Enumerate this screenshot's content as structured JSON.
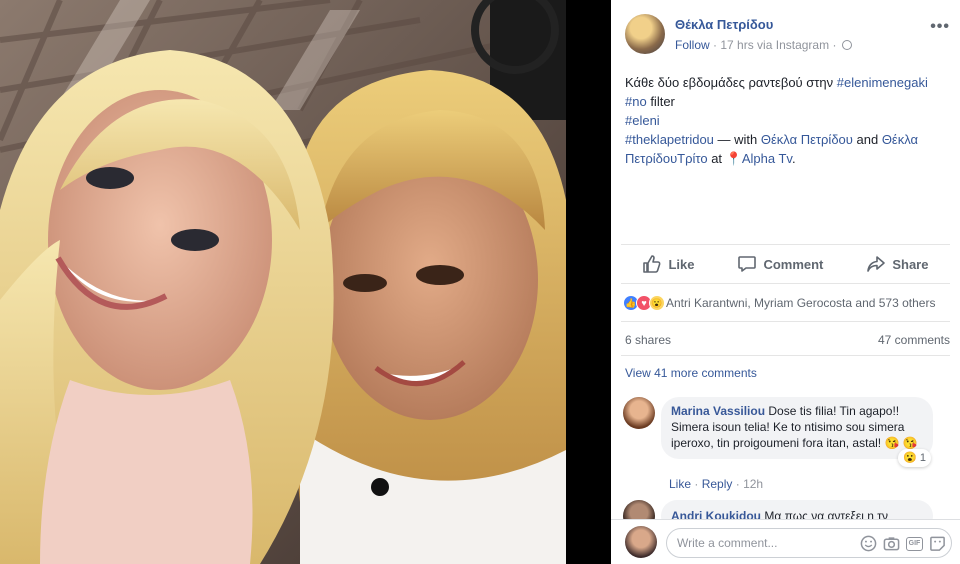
{
  "post": {
    "author": "Θέκλα Πετρίδου",
    "follow_label": "Follow",
    "meta_text": "17 hrs via Instagram",
    "text_line1": "Κάθε δύο εβδομάδες ραντεβού στην ",
    "hashtag_eleni_menegaki": "#elenimenegaki",
    "hashtag_no": "#no",
    "text_filter": " filter",
    "hashtag_eleni": "#eleni",
    "hashtag_theklapetridou": "#theklapetridou",
    "text_with": " — with ",
    "tag1": "Θέκλα Πετρίδου",
    "text_and": " and ",
    "tag2": "Θέκλα ΠετρίδουΤρίτο",
    "text_at": " at ",
    "place": "Alpha Tv",
    "text_end": "."
  },
  "actions": {
    "like": "Like",
    "comment": "Comment",
    "share": "Share"
  },
  "reactions": {
    "summary": "Antri Karantwni, Myriam Gerocosta and 573 others"
  },
  "stats": {
    "shares": "6 shares",
    "comments": "47 comments"
  },
  "view_more": "View 41 more comments",
  "comments": [
    {
      "name": "Marina Vassiliou",
      "text": " Dose tis filia! Tin agapo!! Simera isoun telia! Ke to ntisimo sou simera iperoxo, tin proigoumeni fora itan, astal! 😘 😘",
      "reaction_count": "1",
      "like_label": "Like",
      "reply_label": "Reply",
      "time": "12h"
    },
    {
      "name": "Andri Koukidou",
      "text": " Μα πως να αντεξει η τν"
    }
  ],
  "compose": {
    "placeholder": "Write a comment..."
  },
  "colors": {
    "link": "#365899",
    "meta": "#90949c",
    "like_reaction": "#4080ff",
    "love_reaction": "#f25268",
    "wow_reaction": "#fcd660"
  }
}
